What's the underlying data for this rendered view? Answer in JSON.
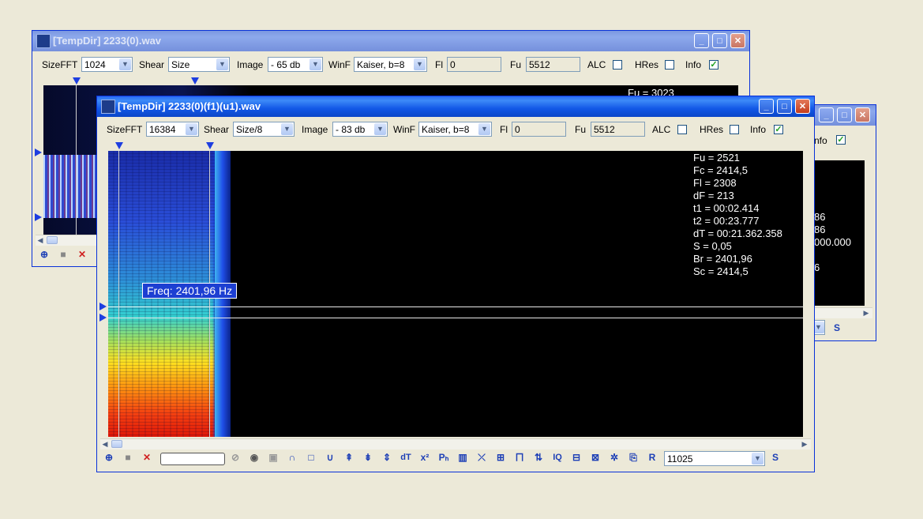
{
  "back_window": {
    "title": "[TempDir] 2233(0).wav",
    "toolbar": {
      "sizefft_label": "SizeFFT",
      "sizefft_value": "1024",
      "shear_label": "Shear",
      "shear_value": "Size",
      "image_label": "Image",
      "image_value": "- 65 db",
      "winf_label": "WinF",
      "winf_value": "Kaiser, b=8",
      "fl_label": "Fl",
      "fl_value": "0",
      "fu_label": "Fu",
      "fu_value": "5512",
      "alc_label": "ALC",
      "hres_label": "HRes",
      "info_label": "Info",
      "info_checked": "✓"
    },
    "info_first_line": "Fu = 3023"
  },
  "right_window": {
    "info_label": "nfo",
    "info_checked": "✓",
    "info_lines": [
      "86",
      "86",
      "000.000",
      "6"
    ],
    "s_button": "S"
  },
  "front_window": {
    "title": "[TempDir] 2233(0)(f1)(u1).wav",
    "toolbar": {
      "sizefft_label": "SizeFFT",
      "sizefft_value": "16384",
      "shear_label": "Shear",
      "shear_value": "Size/8",
      "image_label": "Image",
      "image_value": "- 83 db",
      "winf_label": "WinF",
      "winf_value": "Kaiser, b=8",
      "fl_label": "Fl",
      "fl_value": "0",
      "fu_label": "Fu",
      "fu_value": "5512",
      "alc_label": "ALC",
      "hres_label": "HRes",
      "info_label": "Info",
      "info_checked": "✓"
    },
    "info_lines": [
      "Fu = 2521",
      "Fc = 2414,5",
      "Fl = 2308",
      "dF = 213",
      "t1 = 00:02.414",
      "t2 = 00:23.777",
      "dT = 00:21.362.358",
      "S = 0,05",
      "Br = 2401,96",
      "Sc = 2414,5"
    ],
    "freq_tooltip": "Freq: 2401,96 Hz",
    "bottom": {
      "sample_rate_value": "11025",
      "dt_label": "dT",
      "iq_label": "IQ",
      "r_label": "R",
      "s_label": "S"
    }
  }
}
